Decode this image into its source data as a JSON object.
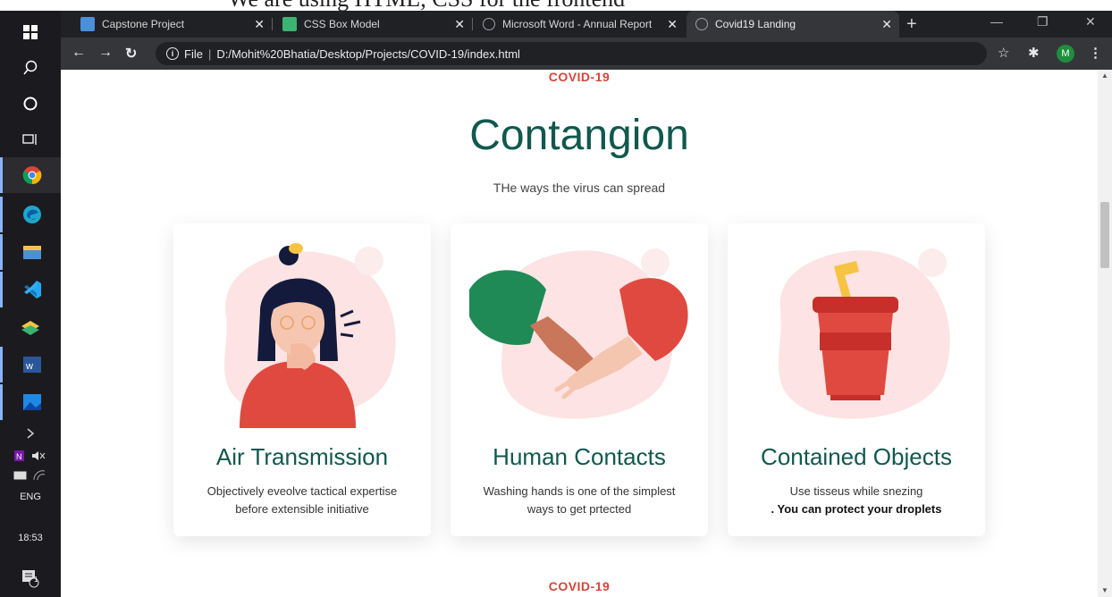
{
  "doc_strip": {
    "text": "We are using HTML, CSS for the frontend"
  },
  "taskbar": {
    "lang": "ENG",
    "time": "18:53",
    "notification_count": "1"
  },
  "browser": {
    "tabs": [
      {
        "title": "Capstone Project",
        "icon": "book-icon",
        "color": "#4a90d9"
      },
      {
        "title": "CSS Box Model",
        "icon": "css-icon",
        "color": "#3cb371"
      },
      {
        "title": "Microsoft Word - Annual Report",
        "icon": "globe-icon",
        "color": "#9aa0a6"
      },
      {
        "title": "Covid19 Landing",
        "icon": "globe-icon",
        "color": "#9aa0a6"
      }
    ],
    "address": {
      "scheme_label": "File",
      "url": "D:/Mohit%20Bhatia/Desktop/Projects/COVID-19/index.html"
    },
    "profile_initial": "M"
  },
  "page": {
    "eyebrow_top": "COVID-19",
    "title": "Contangion",
    "subtitle": "THe ways the virus can spread",
    "cards": [
      {
        "title": "Air Transmission",
        "desc_line1": "Objectively eveolve tactical expertise",
        "desc_line2": "before extensible initiative"
      },
      {
        "title": "Human Contacts",
        "desc_line1": "Washing hands is one of the simplest",
        "desc_line2": "ways to get prtected"
      },
      {
        "title": "Contained Objects",
        "desc_line1": "Use tisseus while snezing",
        "desc_line2": ". You can protect your droplets"
      }
    ],
    "eyebrow_bottom": "COVID-19"
  },
  "colors": {
    "accent_red": "#d9443a",
    "heading_teal": "#11584e",
    "blob_pink": "#fde3e3"
  }
}
